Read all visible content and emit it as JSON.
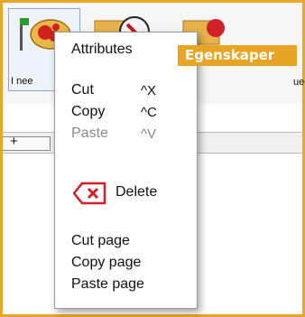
{
  "thumbnails": [
    {
      "label": "I nee",
      "icon": "ladybug-flag-icon"
    },
    {
      "label": "",
      "icon": "folder-warning-icon"
    },
    {
      "label": "ue",
      "icon": "folder-red-icon"
    }
  ],
  "tab_row": {
    "plus": "+"
  },
  "context_menu": {
    "attributes": "Attributes",
    "cut": "Cut",
    "cut_shortcut": "^X",
    "copy": "Copy",
    "copy_shortcut": "^C",
    "paste": "Paste",
    "paste_shortcut": "^V",
    "delete": "Delete",
    "cut_page": "Cut page",
    "copy_page": "Copy page",
    "paste_page": "Paste page"
  },
  "tooltip": {
    "text": "Egenskaper"
  },
  "colors": {
    "accent": "#e6a72a",
    "delete_red": "#d0202a",
    "disabled": "#8a8a8a"
  }
}
